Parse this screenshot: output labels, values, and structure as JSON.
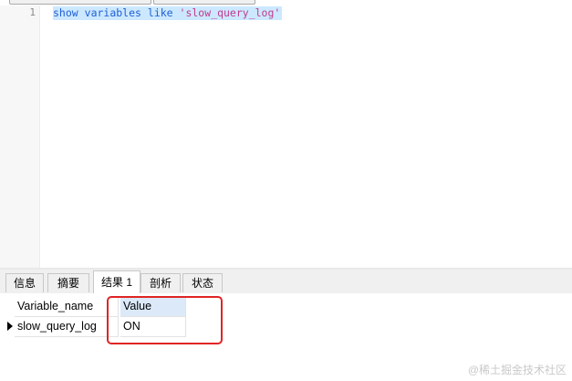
{
  "editor": {
    "line_number": "1",
    "code": {
      "kw1": "show",
      "sp1": " ",
      "kw2": "variables",
      "sp2": " ",
      "kw3": "like",
      "sp3": " ",
      "str": "'slow_query_log'"
    }
  },
  "tabs": [
    {
      "label": "信息"
    },
    {
      "label": "摘要"
    },
    {
      "label": "结果 1",
      "active": true
    },
    {
      "label": "剖析"
    },
    {
      "label": "状态"
    }
  ],
  "grid": {
    "columns": [
      "Variable_name",
      "Value"
    ],
    "rows": [
      [
        "slow_query_log",
        "ON"
      ]
    ]
  },
  "watermark": "@稀土掘金技术社区",
  "colors": {
    "selection": "#cce8ff",
    "keyword": "#1f5fd6",
    "string": "#c23b8c",
    "highlight_box": "#e02424",
    "selected_header": "#dbe9f8"
  }
}
